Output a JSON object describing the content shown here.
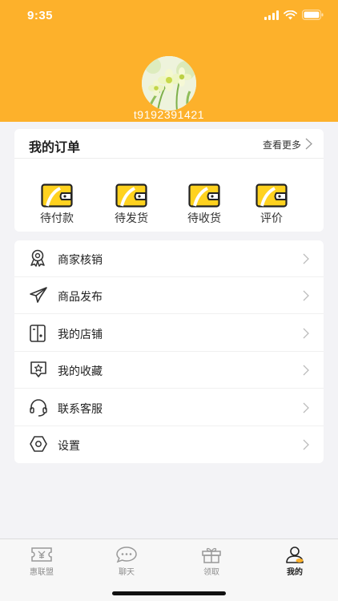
{
  "status": {
    "time": "9:35"
  },
  "profile": {
    "username": "t9192391421"
  },
  "orders": {
    "title": "我的订单",
    "more": "查看更多",
    "items": [
      {
        "label": "待付款",
        "icon": "wallet-icon"
      },
      {
        "label": "待发货",
        "icon": "wallet-icon"
      },
      {
        "label": "待收货",
        "icon": "wallet-icon"
      },
      {
        "label": "评价",
        "icon": "wallet-icon"
      }
    ]
  },
  "menu": [
    {
      "label": "商家核销",
      "icon": "badge-icon"
    },
    {
      "label": "商品发布",
      "icon": "send-icon"
    },
    {
      "label": "我的店铺",
      "icon": "store-icon"
    },
    {
      "label": "我的收藏",
      "icon": "star-icon"
    },
    {
      "label": "联系客服",
      "icon": "headset-icon"
    },
    {
      "label": "设置",
      "icon": "hexagon-icon"
    }
  ],
  "tabbar": [
    {
      "label": "惠联盟",
      "icon": "ticket-icon",
      "active": false
    },
    {
      "label": "聊天",
      "icon": "chat-icon",
      "active": false
    },
    {
      "label": "领取",
      "icon": "gift-icon",
      "active": false
    },
    {
      "label": "我的",
      "icon": "user-icon",
      "active": true
    }
  ],
  "colors": {
    "brand": "#fdb12b",
    "background": "#f3f3f6",
    "text": "#222222",
    "muted": "#8e8e8e"
  }
}
